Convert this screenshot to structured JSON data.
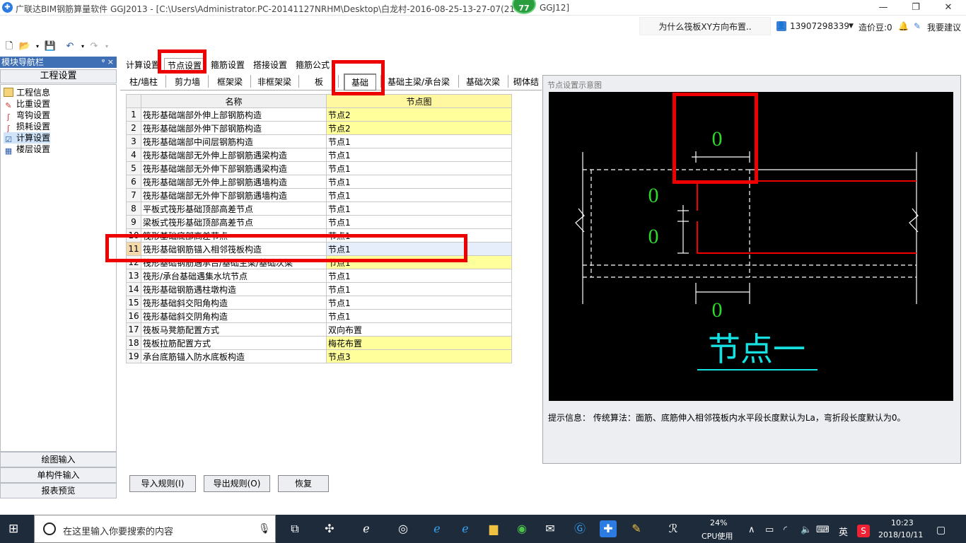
{
  "window": {
    "title": "广联达BIM钢筋算量软件 GGJ2013 - [C:\\Users\\Administrator.PC-20141127NRHM\\Desktop\\白龙村-2016-08-25-13-27-07(21",
    "title_tail": "GGJ12]",
    "minimize": "—",
    "restore": "❐",
    "close": "✕",
    "badge": "77"
  },
  "topbar": {
    "question_link": "为什么筏板XY方向布置..",
    "user_phone": "13907298339",
    "cost_beans": "造价豆:0",
    "suggest": "我要建议"
  },
  "nav": {
    "header": "模块导航栏",
    "pin": "ᵠ ×",
    "section": "工程设置",
    "items": [
      "工程信息",
      "比重设置",
      "弯钩设置",
      "损耗设置",
      "计算设置",
      "楼层设置"
    ],
    "buttons": [
      "绘图输入",
      "单构件输入",
      "报表预览"
    ]
  },
  "main_tabs": [
    "计算设置",
    "节点设置",
    "箍筋设置",
    "搭接设置",
    "箍筋公式"
  ],
  "sub_tabs": [
    "柱/墙柱",
    "剪力墙",
    "框架梁",
    "非框架梁",
    "板",
    "基础",
    "基础主梁/承台梁",
    "基础次梁",
    "砌体结"
  ],
  "grid": {
    "col_name": "名称",
    "col_node": "节点图",
    "rows": [
      {
        "n": "1",
        "name": "筏形基础端部外伸上部钢筋构造",
        "val": "节点2",
        "y": true
      },
      {
        "n": "2",
        "name": "筏形基础端部外伸下部钢筋构造",
        "val": "节点2",
        "y": true
      },
      {
        "n": "3",
        "name": "筏形基础端部中间层钢筋构造",
        "val": "节点1"
      },
      {
        "n": "4",
        "name": "筏形基础端部无外伸上部钢筋遇梁构造",
        "val": "节点1"
      },
      {
        "n": "5",
        "name": "筏形基础端部无外伸下部钢筋遇梁构造",
        "val": "节点1"
      },
      {
        "n": "6",
        "name": "筏形基础端部无外伸上部钢筋遇墙构造",
        "val": "节点1"
      },
      {
        "n": "7",
        "name": "筏形基础端部无外伸下部钢筋遇墙构造",
        "val": "节点1"
      },
      {
        "n": "8",
        "name": "平板式筏形基础顶部高差节点",
        "val": "节点1"
      },
      {
        "n": "9",
        "name": "梁板式筏形基础顶部高差节点",
        "val": "节点1"
      },
      {
        "n": "10",
        "name": "筏形基础底部高差节点",
        "val": "节点1"
      },
      {
        "n": "11",
        "name": "筏形基础钢筋锚入相邻筏板构造",
        "val": "节点1",
        "sel": true
      },
      {
        "n": "12",
        "name": "筏形基础钢筋遇承台/基础主梁/基础次梁",
        "val": "节点1",
        "y": true
      },
      {
        "n": "13",
        "name": "筏形/承台基础遇集水坑节点",
        "val": "节点1"
      },
      {
        "n": "14",
        "name": "筏形基础钢筋遇柱墩构造",
        "val": "节点1"
      },
      {
        "n": "15",
        "name": "筏形基础斜交阳角构造",
        "val": "节点1"
      },
      {
        "n": "16",
        "name": "筏形基础斜交阴角构造",
        "val": "节点1"
      },
      {
        "n": "17",
        "name": "筏板马凳筋配置方式",
        "val": "双向布置"
      },
      {
        "n": "18",
        "name": "筏板拉筋配置方式",
        "val": "梅花布置",
        "y": true
      },
      {
        "n": "19",
        "name": "承台底筋锚入防水底板构造",
        "val": "节点3",
        "y": true
      }
    ]
  },
  "diagram": {
    "panel_title": "节点设置示意图",
    "dim_top": "0",
    "dim_left_upper": "0",
    "dim_left_lower": "0",
    "dim_bottom": "0",
    "caption": "节点一"
  },
  "hint": "提示信息： 传统算法：面筋、底筋伸入相邻筏板内水平段长度默认为La，弯折段长度默认为0。",
  "buttons": {
    "import": "导入规则(I)",
    "export": "导出规则(O)",
    "restore": "恢复"
  },
  "taskbar": {
    "search_placeholder": "在这里输入你要搜索的内容",
    "cpu_percent": "24%",
    "cpu_label": "CPU使用",
    "ime": "英",
    "time": "10:23",
    "date": "2018/10/11"
  }
}
